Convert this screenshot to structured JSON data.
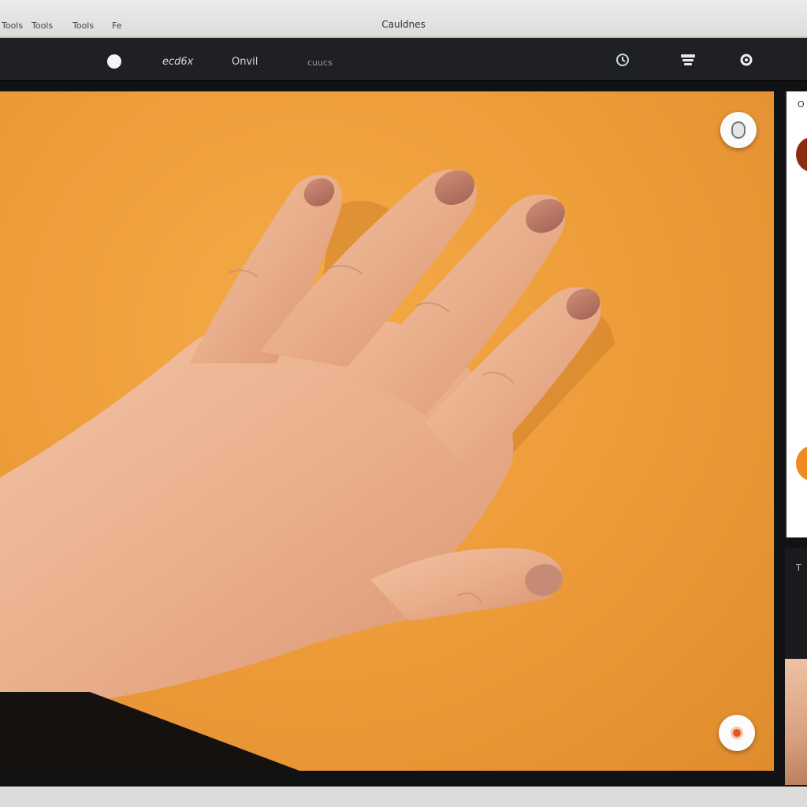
{
  "os_menubar": {
    "items": [
      "Tools",
      "Tools",
      "Tools",
      "Fe"
    ],
    "title": "Cauldnes"
  },
  "toolbar": {
    "items": [
      "ecd6x",
      "Onvil",
      "cuucs"
    ],
    "icons": [
      "record-dot-icon",
      "clock-icon",
      "layers-icon",
      "settings-icon"
    ]
  },
  "canvas": {
    "background_color": "#ec9a38",
    "top_action_icon": "mouse-icon",
    "bottom_action_icon": "record-icon"
  },
  "side_panel": {
    "label": "O",
    "swatches": [
      "#8a2c12",
      "#ef8a1e"
    ],
    "lower_label": "T"
  }
}
